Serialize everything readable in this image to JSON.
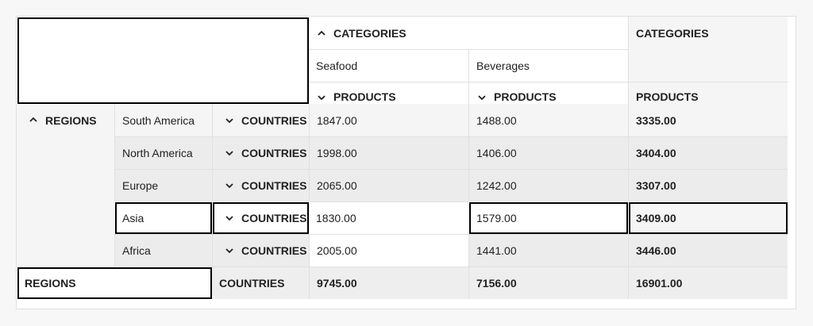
{
  "column_header": {
    "categories_label": "CATEGORIES",
    "categories_total_label": "CATEGORIES",
    "categories": [
      "Seafood",
      "Beverages"
    ],
    "products_label": "PRODUCTS",
    "products_total_label": "PRODUCTS"
  },
  "row_header": {
    "regions_label": "REGIONS",
    "countries_label": "COUNTRIES"
  },
  "rows": [
    {
      "region": "South America",
      "seafood": "1847.00",
      "beverages": "1488.00",
      "total": "3335.00"
    },
    {
      "region": "North America",
      "seafood": "1998.00",
      "beverages": "1406.00",
      "total": "3404.00"
    },
    {
      "region": "Europe",
      "seafood": "2065.00",
      "beverages": "1242.00",
      "total": "3307.00"
    },
    {
      "region": "Asia",
      "seafood": "1830.00",
      "beverages": "1579.00",
      "total": "3409.00"
    },
    {
      "region": "Africa",
      "seafood": "2005.00",
      "beverages": "1441.00",
      "total": "3446.00"
    }
  ],
  "totals_row": {
    "regions_label": "REGIONS",
    "countries_label": "COUNTRIES",
    "seafood": "9745.00",
    "beverages": "7156.00",
    "total": "16901.00"
  },
  "icons": {
    "expanded": "chevron-up-icon",
    "collapsed": "chevron-down-icon"
  }
}
